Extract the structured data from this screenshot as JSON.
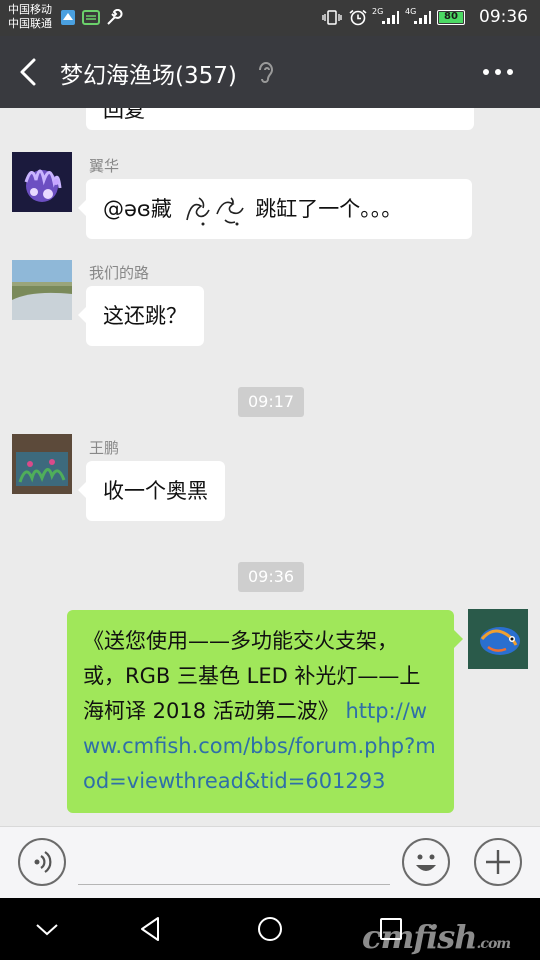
{
  "status_bar": {
    "carrier1": "中国移动",
    "carrier2": "中国联通",
    "network1": "2G",
    "network2": "4G",
    "battery": "80",
    "time": "09:36"
  },
  "header": {
    "title": "梦幻海渔场(357)"
  },
  "messages": {
    "prev_partial": "回复",
    "m1": {
      "sender": "翼华",
      "text_before": "@əɞ藏",
      "text_after": "跳缸了一个。。。"
    },
    "m2": {
      "sender": "我们的路",
      "text": "这还跳？"
    },
    "ts1": "09:17",
    "m3": {
      "sender": "王鹏",
      "text": "收一个奥黑"
    },
    "ts2": "09:36",
    "m4": {
      "text": "《送您使用——多功能交火支架，或，RGB 三基色 LED 补光灯——上海柯译 2018 活动第二波》",
      "link": "http://www.cmfish.com/bbs/forum.php?mod=viewthread&tid=601293"
    }
  },
  "input": {
    "value": ""
  },
  "watermark": {
    "main": "cmfish",
    "suffix": ".com"
  },
  "colors": {
    "header_bg": "#393a3f",
    "my_bubble": "#a0e75a",
    "chat_bg": "#ebebeb"
  }
}
